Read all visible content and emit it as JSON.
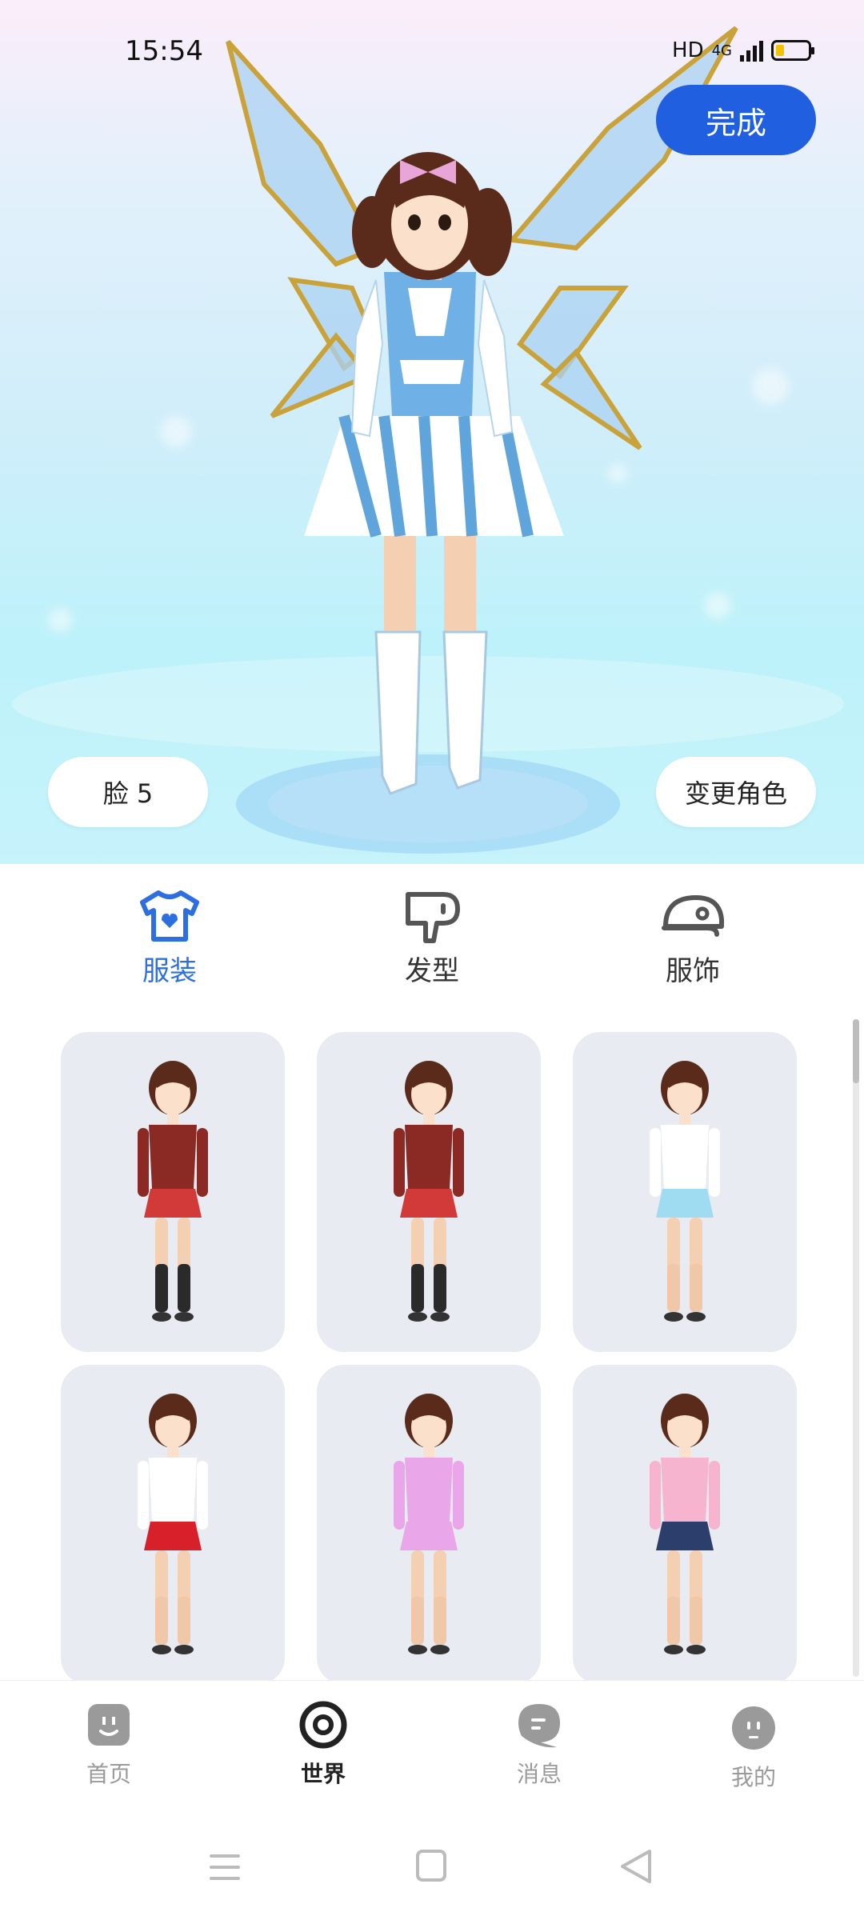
{
  "status": {
    "time": "15:54",
    "network": "HD",
    "network_type": "4G"
  },
  "header": {
    "done_label": "完成"
  },
  "scene": {
    "face_label": "脸 5",
    "change_role_label": "变更角色"
  },
  "tabs": [
    {
      "label": "服装",
      "icon": "shirt-icon",
      "active": true
    },
    {
      "label": "发型",
      "icon": "hair-dryer-icon",
      "active": false
    },
    {
      "label": "服饰",
      "icon": "cap-icon",
      "active": false
    }
  ],
  "outfits": [
    {
      "name": "red-blazer-uniform-1",
      "top": "#8b2a24",
      "bottom": "#d23a3a",
      "legs": "#2a2a2a"
    },
    {
      "name": "red-blazer-uniform-2",
      "top": "#8b2a24",
      "bottom": "#d23a3a",
      "legs": "#2a2a2a"
    },
    {
      "name": "sailor-uniform",
      "top": "#ffffff",
      "bottom": "#9fdcf2",
      "legs": "#f0c8a8"
    },
    {
      "name": "gym-outfit",
      "top": "#ffffff",
      "bottom": "#d8202a",
      "legs": "#f0c8a8"
    },
    {
      "name": "swimsuit",
      "top": "#e9a6e8",
      "bottom": "#e9a6e8",
      "legs": "#f0c8a8"
    },
    {
      "name": "kindergarten-outfit",
      "top": "#f7b4cf",
      "bottom": "#2c3e6b",
      "legs": "#f0c8a8"
    }
  ],
  "nav": [
    {
      "label": "首页",
      "icon": "home-face-icon",
      "active": false
    },
    {
      "label": "世界",
      "icon": "world-target-icon",
      "active": true
    },
    {
      "label": "消息",
      "icon": "message-bubble-icon",
      "active": false
    },
    {
      "label": "我的",
      "icon": "profile-face-icon",
      "active": false
    }
  ],
  "colors": {
    "accent": "#2d6fe0",
    "done_button": "#1f5fe0",
    "card_bg": "#e8ecf2"
  }
}
